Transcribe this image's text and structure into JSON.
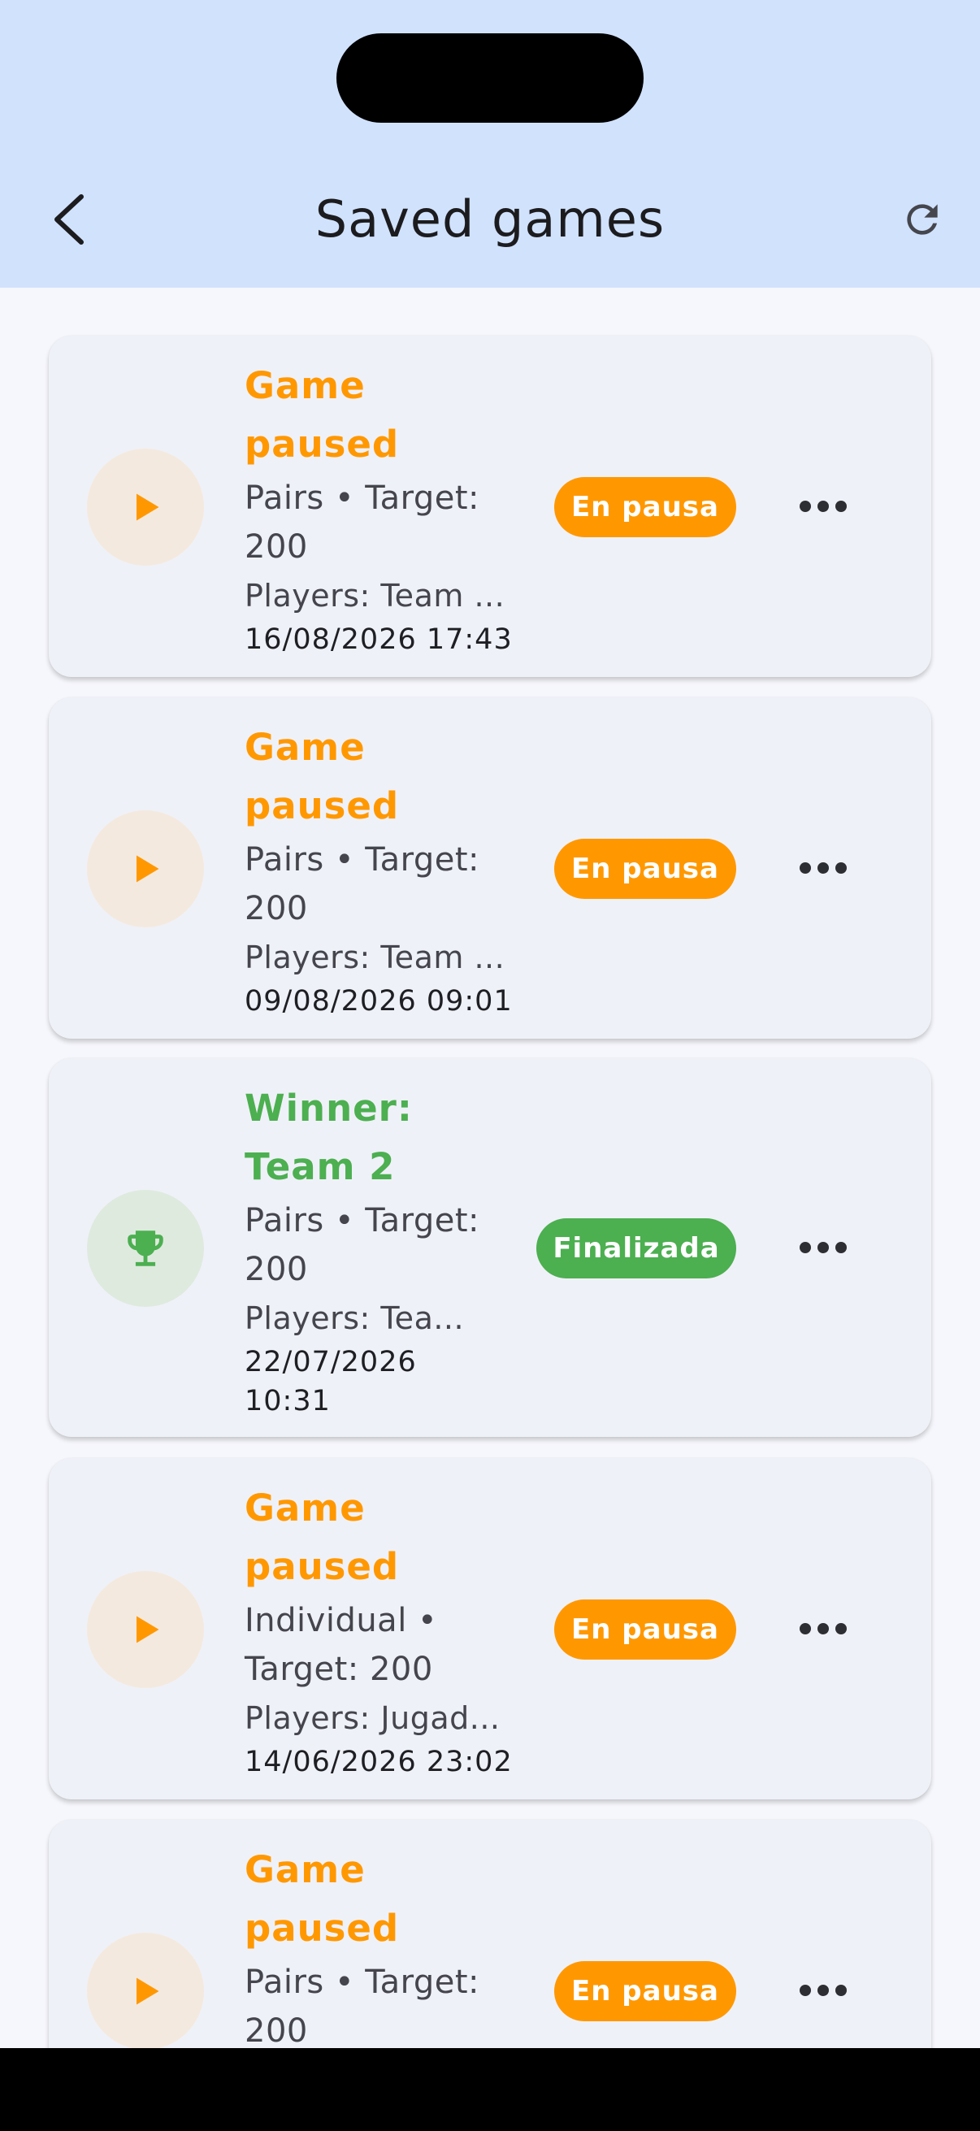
{
  "header": {
    "title": "Saved games",
    "back_icon": "chevron-left-icon",
    "refresh_icon": "refresh-icon"
  },
  "colors": {
    "appbar": "#d1e2fd",
    "paused": "#ff9800",
    "finished": "#4caf50",
    "card": "#eff1f8"
  },
  "games": [
    {
      "title_line1": "Game",
      "title_line2": "paused",
      "meta_line1": "Pairs • Target:",
      "meta_line2": "200",
      "players": "Players: Team ...",
      "date_line1": "16/08/2026 17:43",
      "date_line2": "",
      "status": "En pausa",
      "status_kind": "paused",
      "icon": "play-icon"
    },
    {
      "title_line1": "Game",
      "title_line2": "paused",
      "meta_line1": "Pairs • Target:",
      "meta_line2": "200",
      "players": "Players: Team ...",
      "date_line1": "09/08/2026 09:01",
      "date_line2": "",
      "status": "En pausa",
      "status_kind": "paused",
      "icon": "play-icon"
    },
    {
      "title_line1": "Winner:",
      "title_line2": "Team 2",
      "meta_line1": "Pairs • Target:",
      "meta_line2": "200",
      "players": "Players: Tea...",
      "date_line1": "22/07/2026",
      "date_line2": "10:31",
      "status": "Finalizada",
      "status_kind": "finished",
      "icon": "trophy-icon"
    },
    {
      "title_line1": "Game",
      "title_line2": "paused",
      "meta_line1": "Individual •",
      "meta_line2": "Target: 200",
      "players": "Players: Jugad...",
      "date_line1": "14/06/2026 23:02",
      "date_line2": "",
      "status": "En pausa",
      "status_kind": "paused",
      "icon": "play-icon"
    },
    {
      "title_line1": "Game",
      "title_line2": "paused",
      "meta_line1": "Pairs • Target:",
      "meta_line2": "200",
      "players": "",
      "date_line1": "",
      "date_line2": "",
      "status": "En pausa",
      "status_kind": "paused",
      "icon": "play-icon"
    }
  ]
}
